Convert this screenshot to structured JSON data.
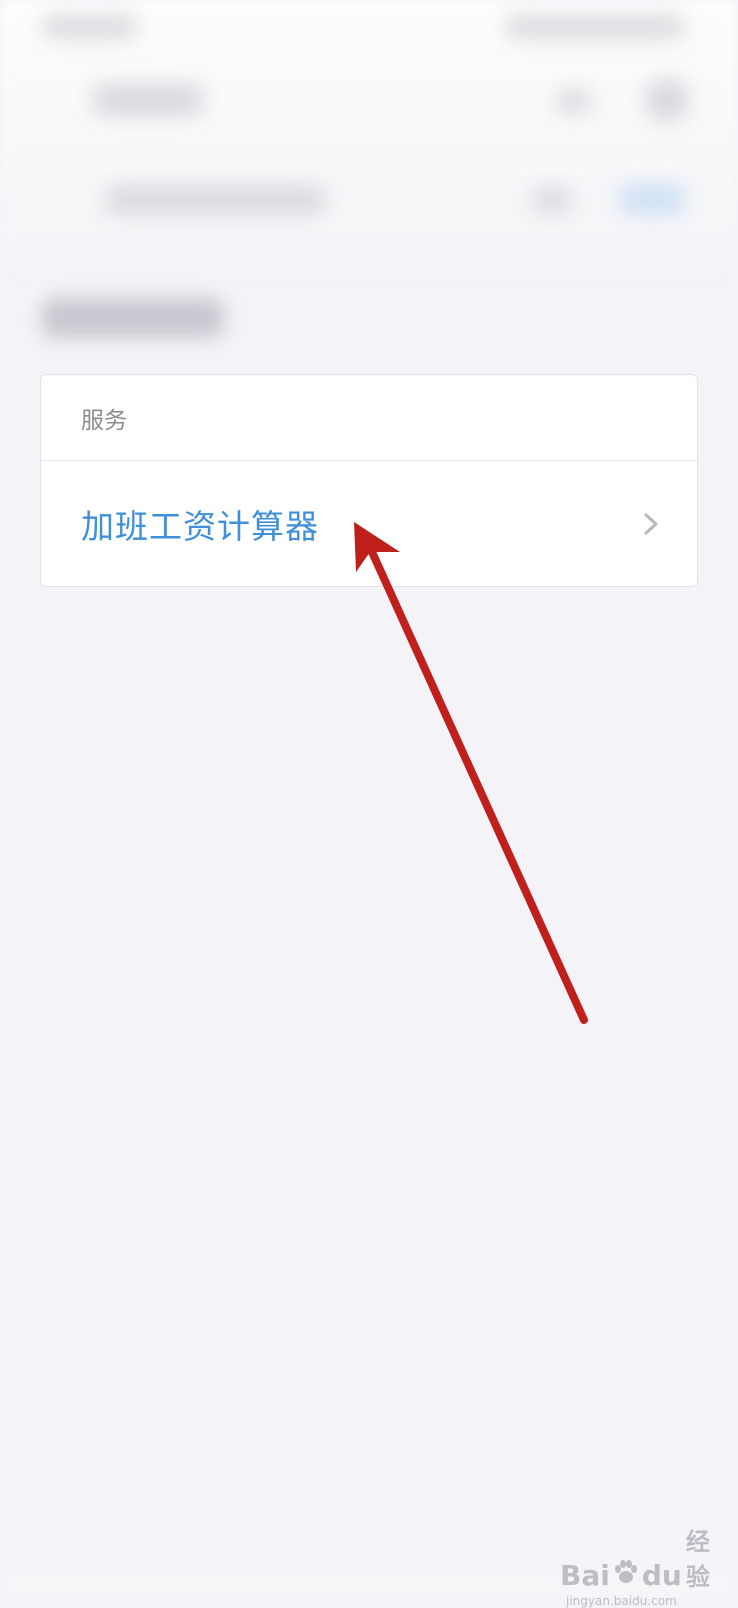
{
  "card": {
    "header": "服务",
    "item_label": "加班工资计算器"
  },
  "annotation": {
    "arrow_color": "#c0201c"
  },
  "watermark": {
    "logo_latin_1": "Bai",
    "logo_latin_2": "du",
    "logo_cn": "经验",
    "url": "jingyan.baidu.com"
  },
  "icons": {
    "row_chevron": "chevron-right-icon",
    "watermark_paw": "paw-icon"
  },
  "colors": {
    "accent": "#3f8fda",
    "background": "#f3f3f8"
  }
}
